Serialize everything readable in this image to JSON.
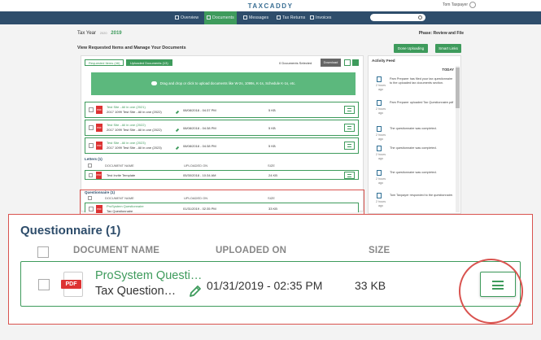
{
  "app": {
    "logo": "TAXCADDY",
    "user_name": "Tom Taxpayer"
  },
  "nav": {
    "items": [
      "Overview",
      "Documents",
      "Messages",
      "Tax Returns",
      "Invoices"
    ],
    "active": "Documents"
  },
  "page": {
    "tax_year_label": "Tax Year",
    "tax_year_prev": "2020",
    "tax_year": "2019",
    "phase": "Phase: Review and File",
    "subtitle": "View Requested Items and Manage Your Documents",
    "done_uploading": "Done Uploading",
    "smart_links": "Smart Links"
  },
  "documents": {
    "tab_requested": "Requested Items (46)",
    "tab_uploaded": "Uploaded Documents (13)",
    "selected_count": "0 Documents Selected",
    "download_label": "Download",
    "dropzone_text": "Drag and drop or click to upload documents like W-2s, 1099s, K-1s, Schedule K-1s, etc.",
    "rows": [
      {
        "name": "Test Site - All in one (2021)",
        "sub": "2017 1099 Test Site - All in one (2022)",
        "date": "08/08/2018 - 04:37 PM",
        "size": "5 KB"
      },
      {
        "name": "Test Site - All in one (2022)",
        "sub": "2017 1099 Test Site - All in one (2022)",
        "date": "08/08/2018 - 04:38 PM",
        "size": "5 KB"
      },
      {
        "name": "Test Site - All in one (2023)",
        "sub": "2017 1099 Test Site - All in one (2023)",
        "date": "08/08/2018 - 04:38 PM",
        "size": "5 KB"
      }
    ],
    "letters": {
      "title": "Letters (1)",
      "headers": {
        "name": "DOCUMENT NAME",
        "uploaded": "UPLOADED ON",
        "size": "SIZE"
      },
      "row": {
        "name": "Test Invite Template",
        "date": "05/30/2018 - 10:34 AM",
        "size": "24 KB"
      }
    },
    "questionnaire_small": {
      "title": "Questionnaire (1)",
      "headers": {
        "name": "DOCUMENT NAME",
        "uploaded": "UPLOADED ON",
        "size": "SIZE"
      },
      "row": {
        "name": "ProSystem Questionnaire",
        "sub": "Tax Questionnaire",
        "date": "01/31/2019 - 02:35 PM",
        "size": "33 KB"
      }
    }
  },
  "activity_feed": {
    "title": "Activity Feed",
    "today": "TODAY",
    "items": [
      {
        "time": "2 hours ago",
        "text": "Pam Preparer has filed your tax questionnaire to the uploaded tax documents section."
      },
      {
        "time": "2 hours ago",
        "text": "Pam Preparer uploaded Tax Questionnaire.pdf"
      },
      {
        "time": "2 hours ago",
        "text": "The questionnaire was completed."
      },
      {
        "time": "2 hours ago",
        "text": "The questionnaire was completed."
      },
      {
        "time": "2 hours ago",
        "text": "The questionnaire was completed."
      },
      {
        "time": "2 hours ago",
        "text": "Tom Taxpayer responded to the questionnaire."
      }
    ]
  },
  "zoom": {
    "title": "Questionnaire (1)",
    "headers": {
      "name": "DOCUMENT NAME",
      "uploaded": "UPLOADED ON",
      "size": "SIZE"
    },
    "pdf_label": "PDF",
    "row": {
      "name": "ProSystem Questi…",
      "sub": "Tax Question…",
      "date": "01/31/2019 - 02:35 PM",
      "size": "33 KB"
    }
  },
  "colors": {
    "accent": "#3e9b5c",
    "navy": "#2e4d6b",
    "highlight": "#d9534f"
  }
}
